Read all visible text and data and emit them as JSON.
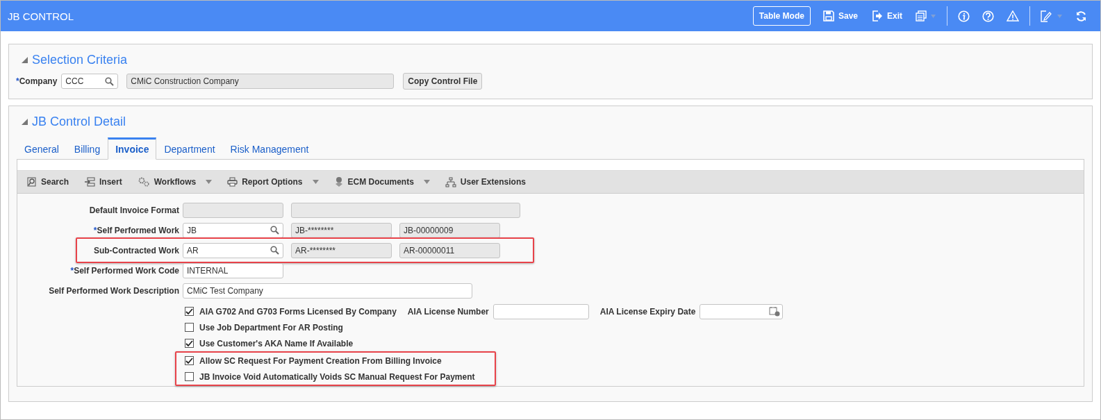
{
  "header": {
    "title": "JB CONTROL",
    "buttons": [
      {
        "kind": "outlined",
        "label": "Table Mode"
      },
      {
        "kind": "save",
        "label": "Save"
      },
      {
        "kind": "exit",
        "label": "Exit"
      }
    ]
  },
  "selection": {
    "title": "Selection Criteria",
    "company": {
      "label": "Company",
      "required_mark": "*",
      "value": "CCC",
      "description": "CMiC Construction Company"
    },
    "copy_button": "Copy Control File"
  },
  "detail": {
    "title": "JB Control Detail",
    "tabs": [
      {
        "label": "General",
        "selected": false
      },
      {
        "label": "Billing",
        "selected": false
      },
      {
        "label": "Invoice",
        "selected": true
      },
      {
        "label": "Department",
        "selected": false
      },
      {
        "label": "Risk Management",
        "selected": false
      }
    ],
    "toolbar": [
      {
        "kind": "search",
        "label": "Search",
        "has_menu": false
      },
      {
        "kind": "insert",
        "label": "Insert",
        "has_menu": false
      },
      {
        "kind": "workflows",
        "label": "Workflows",
        "has_menu": true
      },
      {
        "kind": "print",
        "label": "Report Options",
        "has_menu": true
      },
      {
        "kind": "ecm",
        "label": "ECM Documents",
        "has_menu": true
      },
      {
        "kind": "hierarchy",
        "label": "User Extensions",
        "has_menu": false
      }
    ],
    "fields": [
      {
        "label": "Default Invoice Format",
        "highlighted": false,
        "inputs": [
          {
            "kind": "readonly"
          },
          {
            "kind": "readonly-wide"
          }
        ]
      },
      {
        "label": "Self Performed Work",
        "required_mark": "*",
        "highlighted": false,
        "inputs": [
          {
            "kind": "lookup",
            "value": "JB"
          },
          {
            "kind": "readonly",
            "value": "JB-********"
          },
          {
            "kind": "readonly",
            "value": "JB-00000009"
          }
        ]
      },
      {
        "label": "Sub-Contracted Work",
        "highlighted": true,
        "inputs": [
          {
            "kind": "lookup",
            "value": "AR"
          },
          {
            "kind": "readonly",
            "value": "AR-********"
          },
          {
            "kind": "readonly",
            "value": "AR-00000011"
          }
        ]
      },
      {
        "label": "Self Performed Work Code",
        "required_mark": "*",
        "highlighted": false,
        "inputs": [
          {
            "kind": "text",
            "value": "INTERNAL"
          }
        ]
      },
      {
        "label": "Self Performed Work Description",
        "highlighted": false,
        "inputs": [
          {
            "kind": "text-wide",
            "value": "CMiC Test Company"
          }
        ]
      }
    ],
    "checkboxes": [
      {
        "label": "AIA G702 And G703 Forms Licensed By Company",
        "checked": true,
        "highlighted": false,
        "extras": [
          {
            "kind": "text",
            "label": "AIA License Number"
          },
          {
            "kind": "date",
            "label": "AIA License Expiry Date"
          }
        ]
      },
      {
        "label": "Use Job Department For AR Posting",
        "checked": false,
        "highlighted": false
      },
      {
        "label": "Use Customer's AKA Name If Available",
        "checked": true,
        "highlighted": false
      },
      {
        "label": "Allow SC Request For Payment Creation From Billing Invoice",
        "checked": true,
        "highlighted": true
      },
      {
        "label": "JB Invoice Void Automatically Voids SC Manual Request For Payment",
        "checked": false,
        "highlighted": true
      }
    ]
  }
}
